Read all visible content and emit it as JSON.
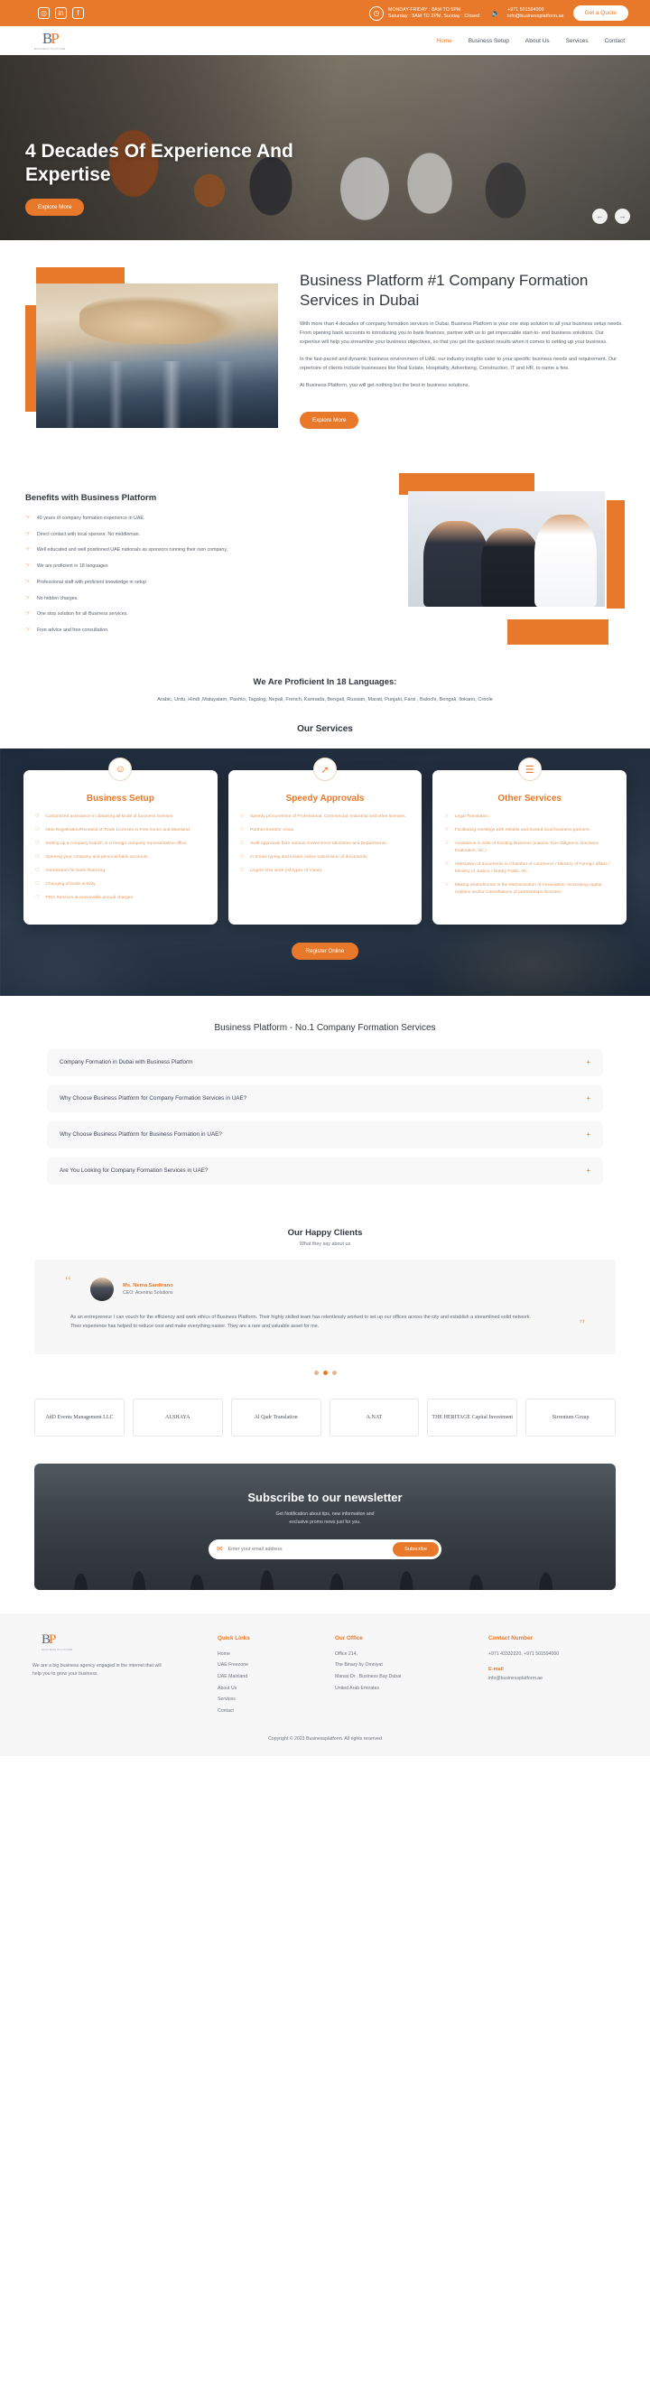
{
  "topbar": {
    "social": [
      {
        "name": "instagram-icon",
        "glyph": "◎"
      },
      {
        "name": "linkedin-icon",
        "glyph": "in"
      },
      {
        "name": "facebook-icon",
        "glyph": "f"
      }
    ],
    "hours_line1": "MONDAY-FRIDAY : 8AM TO 5PM",
    "hours_line2": "Saturday : 9AM TO 2PM, Sunday : Closed",
    "phone": "+971 501594000",
    "email": "info@businessplatform.ae",
    "quote_label": "Get a Quote",
    "clock_icon": "clock-icon",
    "mic_icon": "microphone-icon",
    "accent": "#e8792a"
  },
  "brand": {
    "mark": "BP",
    "tagline": "BUSINESS PLATFORM"
  },
  "nav": {
    "items": [
      {
        "label": "Home",
        "active": true
      },
      {
        "label": "Business Setup",
        "active": false
      },
      {
        "label": "About Us",
        "active": false
      },
      {
        "label": "Services",
        "active": false
      },
      {
        "label": "Contact",
        "active": false
      }
    ]
  },
  "hero": {
    "title": "4 Decades Of Experience And Expertise",
    "cta": "Explore More",
    "prev_icon": "arrow-left-icon",
    "next_icon": "arrow-right-icon"
  },
  "intro": {
    "heading": "Business Platform #1 Company Formation Services in Dubai",
    "p1": "With more than 4 decades of company formation services in Dubai, Business Platform is your one stop solution to all your business setup needs. From opening bank accounts to introducing you to bank finances, partner with us to get impeccable start-to- end business solutions. Our expertise will help you streamline your business objectives, so that you get the quickest results when it comes to setting up your business.",
    "p2": "In the fast-paced and dynamic business environment of UAE, our industry insights cater to your specific business needs and requirement. Our repertoire of clients include businesses like Real Estate, Hospitality, Advertising, Construction, IT and HR, to name a few.",
    "p3": "At Business Platform, you will get nothing but the best in business solutions.",
    "cta": "Explore More"
  },
  "benefits": {
    "heading": "Benefits with Business Platform",
    "items": [
      "40 years of company formation experience in UAE.",
      "Direct contact with local sponsor. No middleman.",
      "Well educated and well positioned UAE nationals as sponsors running their own company.",
      "We are proficient in 18 languages",
      "Professional staff with proficient knowledge in setup",
      "No hidden charges.",
      "One stop solution for all Business services.",
      "Free advice and free consultation."
    ]
  },
  "languages": {
    "heading": "We Are Proficient In 18 Languages:",
    "list": "Arabic, Urdu, Hindi ,Malayalam, Pashto, Tagalog, Nepali, French, Kannada, Bengali, Russian, Marati, Punjabi, Farsi , Balochi, Bengali, Ilokano, Creole"
  },
  "services": {
    "heading": "Our Services",
    "register_label": "Register Online",
    "cards": [
      {
        "icon": "handshake-icon",
        "glyph": "🤝",
        "title": "Business Setup",
        "items": [
          "Customized assistance in obtaining all kinds of business licenses.",
          "New Registration/Renewal of Trade Licenses in Free zones and Mainland.",
          "Setting up a company branch or a foreign company representative office.",
          "Opening your company and personal bank accounts.",
          "Introduction for bank financing.",
          "Changing of trade activity.",
          "PRO Services at reasonable annual charges."
        ]
      },
      {
        "icon": "rocket-icon",
        "glyph": "🚀",
        "title": "Speedy Approvals",
        "items": [
          "Speedy procurement of Professional, Commercial, Industrial and other licenses.",
          "Partner/Investor Visas.",
          "Swift approvals from various Government Ministries and Departments.",
          "In house typing and instant online submission of documents.",
          "Urgent Visa work (All types of Visas)."
        ]
      },
      {
        "icon": "briefcase-icon",
        "glyph": "💼",
        "title": "Other Services",
        "items": [
          "Legal Translation.",
          "Facilitating meetings with reliable and trusted local business partners.",
          "Assistance in Sale of Existing Business (Liaison, Due Diligence, Business Evaluation, etc.)",
          "Attestation of documents in Chamber of commerce / Ministry of Foreign affairs / Ministry of Justice / Notary Public etc.",
          "Making amendments in the Memorandum of Association,  Increasing capital, Addition and/or Cancellations of partnerships /licenses ."
        ]
      }
    ]
  },
  "faq": {
    "heading": "Business Platform - No.1 Company Formation Services",
    "items": [
      {
        "q": "Company Formation in Dubai with Business Platform",
        "toggle": "+"
      },
      {
        "q": "Why Choose Business Platform for Company Formation Services in UAE?",
        "toggle": "+"
      },
      {
        "q": "Why Choose Business Platform for Business Formation in UAE?",
        "toggle": "+"
      },
      {
        "q": "Are You Looking for Company Formation Services in UAE?",
        "toggle": "+"
      }
    ]
  },
  "testimonials": {
    "heading": "Our Happy Clients",
    "subheading": "What they say about us",
    "quote_open": "“",
    "quote_close": "”",
    "name": "Ms. Nema Sardirano",
    "role": "CEO: Acentria Solutions",
    "body": "As an entrepreneur I can vouch for the efficiency and work ethics of Business Platform. Their highly skilled team has relentlessly worked to set up our offices across the city and establish a streamlined solid network. Their experience has helped to reduce cost and make everything easier. They are a rare and valuable asset for me.",
    "dots": 3,
    "active_dot": 1
  },
  "client_logos": [
    "AñD Events Management LLC",
    "ALSHAYA",
    "Al Qadr Translation",
    "A.NAT",
    "THE HERITAGE Capital Investment",
    "Sirrentum Group"
  ],
  "newsletter": {
    "heading": "Subscribe to our newsletter",
    "sub1": "Get Notification about tips, new information and",
    "sub2": "exclusive promo news just for you.",
    "placeholder": "Enter your email address",
    "button": "Subscribe",
    "mail_icon": "envelope-icon"
  },
  "footer": {
    "about": "We are a big business agency engaged in the internet that will help you to grow your business.",
    "quick_links": {
      "title": "Quick Links",
      "items": [
        "Home",
        "UAE Freezone",
        "UAE Mainland",
        "About Us",
        "Services",
        "Contact"
      ]
    },
    "office": {
      "title": "Our Office",
      "lines": [
        "Office 214,",
        "The Binary by Omniyat",
        "Marasi Dr . Business Bay Dubai",
        "United Arab Emirates"
      ]
    },
    "contact": {
      "title": "Contact Number",
      "phones": "+971 43332220, +971 501594000",
      "email_label": "E-mail",
      "email": "info@businessplatform.ae"
    },
    "copyright": "Copyright © 2023 Businessplatform. All rights reserved"
  }
}
